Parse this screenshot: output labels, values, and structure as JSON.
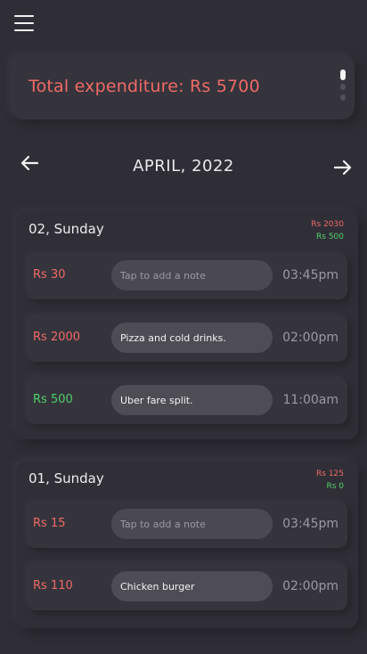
{
  "header": {
    "menu_icon": "hamburger-menu-icon"
  },
  "summary": {
    "total_text": "Total expenditure: Rs 5700",
    "options_icon": "kebab-menu-icon"
  },
  "month_nav": {
    "label": "APRIL, 2022",
    "prev_icon": "arrow-left-icon",
    "next_icon": "arrow-right-icon"
  },
  "colors": {
    "expense": "#f06a66",
    "income": "#4fd06a",
    "background": "#2f2e36"
  },
  "days": [
    {
      "title": "02, Sunday",
      "sum_out": "Rs 2030",
      "sum_in": "Rs 500",
      "entries": [
        {
          "amount": "Rs 30",
          "type": "expense",
          "note": "",
          "placeholder": "Tap to add a note",
          "time": "03:45pm"
        },
        {
          "amount": "Rs 2000",
          "type": "expense",
          "note": "Pizza and cold drinks.",
          "placeholder": "Tap to add a note",
          "time": "02:00pm"
        },
        {
          "amount": "Rs 500",
          "type": "income",
          "note": "Uber fare split.",
          "placeholder": "Tap to add a note",
          "time": "11:00am"
        }
      ]
    },
    {
      "title": "01, Sunday",
      "sum_out": "Rs 125",
      "sum_in": "Rs 0",
      "entries": [
        {
          "amount": "Rs 15",
          "type": "expense",
          "note": "",
          "placeholder": "Tap to add a note",
          "time": "03:45pm"
        },
        {
          "amount": "Rs 110",
          "type": "expense",
          "note": "Chicken burger",
          "placeholder": "Tap to add a note",
          "time": "02:00pm"
        }
      ]
    }
  ]
}
